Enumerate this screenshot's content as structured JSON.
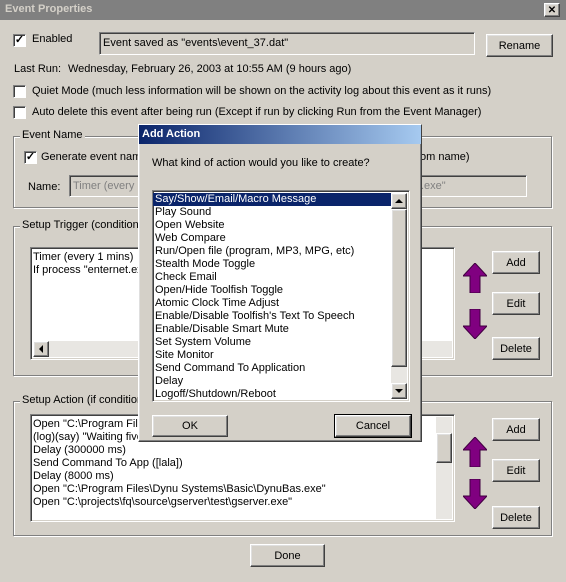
{
  "window": {
    "title": "Event Properties",
    "close_glyph": "✕"
  },
  "enabled": {
    "label": "Enabled",
    "checked": true,
    "check_glyph": "✓"
  },
  "status_message": "Event saved as \"events\\event_37.dat\"",
  "rename_label": "Rename",
  "last_run": {
    "label": "Last Run:",
    "value": "Wednesday, February 26, 2003 at 10:55 AM (9 hours ago)"
  },
  "quiet_mode": {
    "label": "Quiet Mode (much less information will be shown on the activity log about this event as it runs)",
    "checked": false
  },
  "auto_delete": {
    "label": "Auto delete this event after being run (Except if run by clicking Run from the Event Manager)",
    "checked": false
  },
  "event_name": {
    "group_label": "Event Name",
    "generate_label": "Generate event nam",
    "generate_tail": "om  name)",
    "generate_checked": true,
    "name_label": "Name:",
    "name_value": "Timer (every 1",
    "name_tail": ".exe\""
  },
  "setup_trigger": {
    "group_label": "Setup Trigger (condition",
    "items": [
      "Timer (every 1 mins)",
      "If process \"enternet.ex"
    ],
    "add_label": "Add",
    "edit_label": "Edit",
    "delete_label": "Delete"
  },
  "setup_action": {
    "group_label": "Setup Action (if condition",
    "items": [
      "Open \"C:\\Program File",
      "(log)(say) \"Waiting five",
      "Delay (300000 ms)",
      "Send Command To App ([lala])",
      "Delay (8000 ms)",
      "Open \"C:\\Program Files\\Dynu Systems\\Basic\\DynuBas.exe\"",
      "Open \"C:\\projects\\fq\\source\\gserver\\test\\gserver.exe\""
    ],
    "add_label": "Add",
    "edit_label": "Edit",
    "delete_label": "Delete"
  },
  "done_label": "Done",
  "add_action_dialog": {
    "title": "Add Action",
    "prompt": "What kind of action would you like to create?",
    "options": [
      "Say/Show/Email/Macro Message",
      "Play Sound",
      "Open Website",
      "Web Compare",
      "Run/Open file (program, MP3, MPG, etc)",
      "Stealth Mode Toggle",
      "Check Email",
      "Open/Hide Toolfish Toggle",
      "Atomic Clock Time Adjust",
      "Enable/Disable Toolfish's Text To Speech",
      "Enable/Disable Smart Mute",
      "Set System Volume",
      "Site Monitor",
      "Send Command To Application",
      "Delay",
      "Logoff/Shutdown/Reboot"
    ],
    "selected_index": 0,
    "ok_label": "OK",
    "cancel_label": "Cancel"
  },
  "colors": {
    "selection": "#0a246a",
    "dialog_title_start": "#0a246a",
    "dialog_title_end": "#a6caf0",
    "arrow_purple": "#800080"
  }
}
